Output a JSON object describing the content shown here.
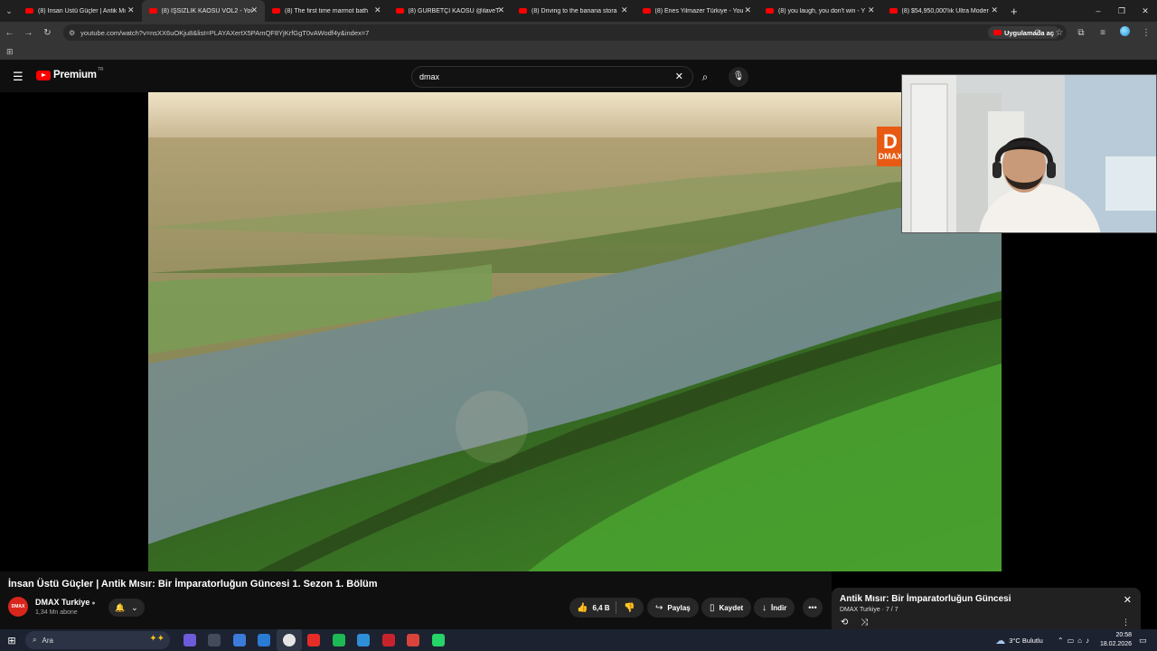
{
  "browser": {
    "tabs": [
      {
        "label": "(8) İnsan Üstü Güçler | Antik Mı",
        "active": false
      },
      {
        "label": "(8) İŞSİZLİK KAOSU VOL2 - You",
        "active": true
      },
      {
        "label": "(8) The first time marmot bath",
        "active": false
      },
      {
        "label": "(8) GURBETÇİ KAOSU @ilaveTv",
        "active": false
      },
      {
        "label": "(8) Driving to the banana stora",
        "active": false
      },
      {
        "label": "(8) Enes Yilmazer Türkiye - You",
        "active": false
      },
      {
        "label": "(8) you laugh, you don't win - Y",
        "active": false
      },
      {
        "label": "(8) $54,950,000'lık Ultra Moder",
        "active": false
      }
    ],
    "url": "youtube.com/watch?v=nsXX6uOKju8&list=PLAYAXertX5PAmQF8YjKrfGgT0vAWodf4y&index=7",
    "open_in_app": "Uygulamada aç"
  },
  "youtube": {
    "logo_text": "Premium",
    "country_code": "TR",
    "search_value": "dmax",
    "video_logo": {
      "big": "D",
      "small": "DMAX"
    },
    "video_title": "İnsan Üstü Güçler | Antik Mısır: Bir İmparatorluğun Güncesi 1. Sezon 1. Bölüm",
    "channel": {
      "name": "DMAX Turkiye",
      "subscribers": "1,34 Mn abone",
      "avatar_text": "DMAX"
    },
    "actions": {
      "likes": "6,4 B",
      "share": "Paylaş",
      "save": "Kaydet",
      "download": "İndir"
    },
    "playlist": {
      "title": "Antik Mısır: Bir İmparatorluğun Güncesi",
      "channel": "DMAX Turkiye",
      "position": "7 / 7"
    }
  },
  "taskbar": {
    "search_placeholder": "Ara",
    "weather": "3°C Bulutlu",
    "time": "20:58",
    "date": "18.02.2026",
    "app_colors": [
      "#6e5bd9",
      "#444b5c",
      "#3b7bd9",
      "#2a7bd4",
      "#e5e5e5",
      "#e52d27",
      "#1db954",
      "#2f8fd6",
      "#c8232c",
      "#d9443a",
      "#25d366"
    ]
  }
}
